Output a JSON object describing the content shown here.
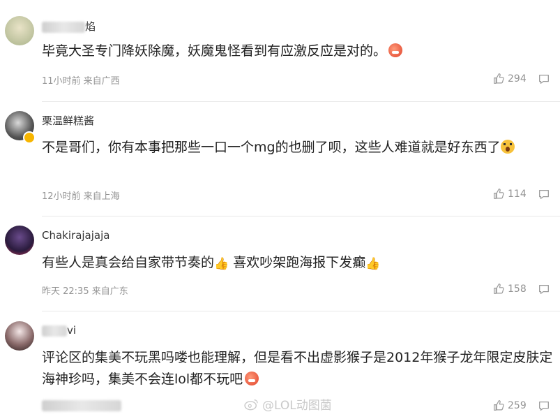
{
  "comments": [
    {
      "username": "焰",
      "text": "毕竟大圣专门降妖除魔，妖魔鬼怪看到有应激反应是对的。",
      "time_location": "11小时前 来自广西",
      "likes": "294"
    },
    {
      "username": "栗温鲜糕酱",
      "text": "不是哥们，你有本事把那些一口一个mg的也删了呗，这些人难道就是好东西了",
      "time_location": "12小时前 来自上海",
      "likes": "114"
    },
    {
      "username": "Chakirajajaja",
      "text_part1": "有些人是真会给自家带节奏的",
      "text_part2": " 喜欢吵架跑海报下发癫",
      "time_location": "昨天 22:35 来自广东",
      "likes": "158"
    },
    {
      "username": "vi",
      "text": "评论区的集美不玩黑吗喽也能理解，但是看不出虚影猴子是2012年猴子龙年限定皮肤定海神珍吗，集美不会连lol都不玩吧",
      "time_location": "",
      "likes": "259"
    }
  ],
  "watermark": "@LOL动图菌",
  "icons": [
    "like-icon",
    "reply-icon",
    "weibo-icon"
  ]
}
